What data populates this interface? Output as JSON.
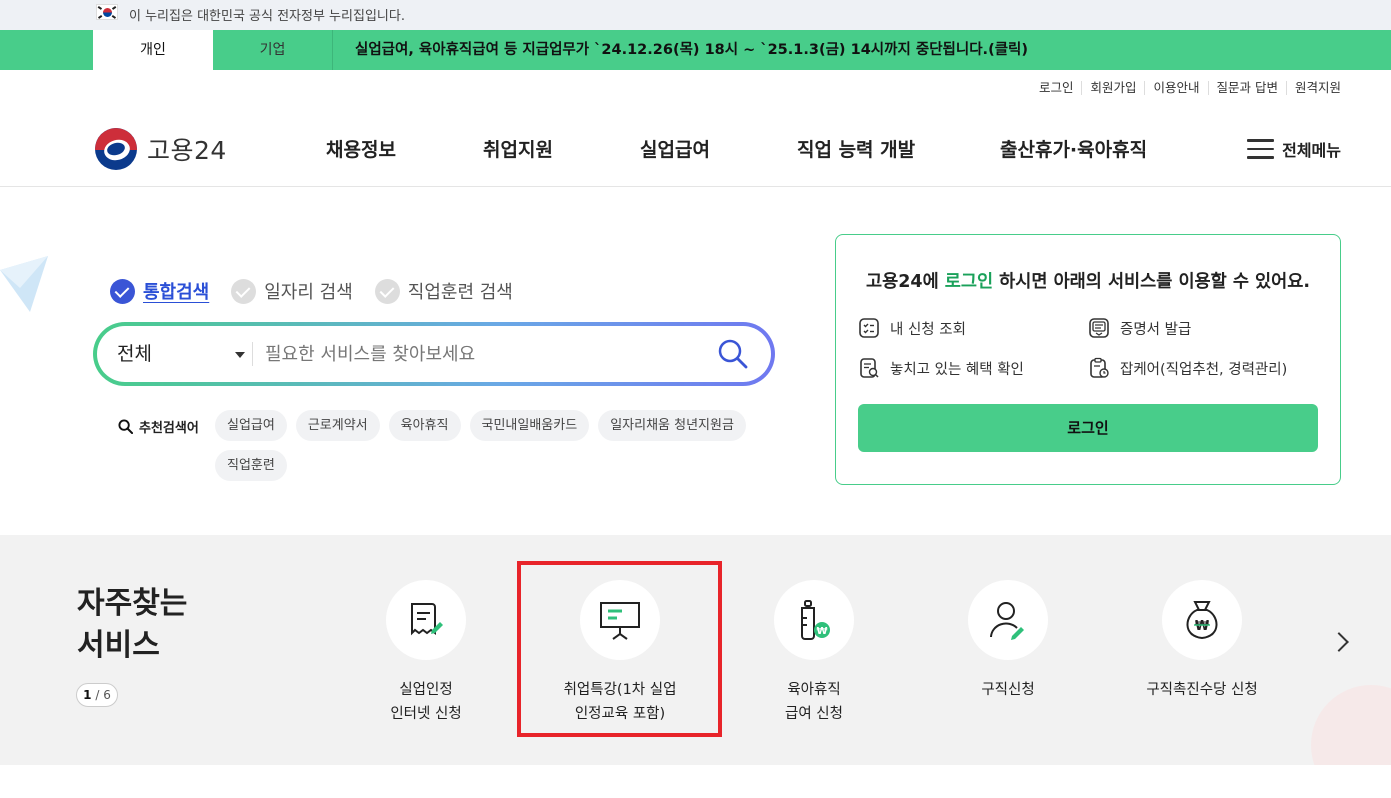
{
  "gov_banner": {
    "text": "이 누리집은 대한민국 공식 전자정부 누리집입니다."
  },
  "user_tabs": {
    "personal": "개인",
    "business": "기업"
  },
  "notice": "실업급여, 육아휴직급여 등 지급업무가 `24.12.26(목) 18시 ~ `25.1.3(금) 14시까지 중단됩니다.(클릭)",
  "util_links": [
    "로그인",
    "회원가입",
    "이용안내",
    "질문과 답변",
    "원격지원"
  ],
  "logo": {
    "name": "고용24"
  },
  "gnb": [
    "채용정보",
    "취업지원",
    "실업급여",
    "직업 능력 개발",
    "출산휴가·육아휴직"
  ],
  "menu_all": "전체메뉴",
  "search": {
    "tabs": [
      "통합검색",
      "일자리 검색",
      "직업훈련 검색"
    ],
    "active_tab": 0,
    "category": "전체",
    "placeholder": "필요한 서비스를 찾아보세요",
    "keyword_label": "추천검색어",
    "keywords": [
      "실업급여",
      "근로계약서",
      "육아휴직",
      "국민내일배움카드",
      "일자리채움 청년지원금",
      "직업훈련"
    ]
  },
  "login_box": {
    "title_prefix": "고용24에 ",
    "title_highlight": "로그인",
    "title_suffix": " 하시면 아래의 서비스를 이용할 수 있어요.",
    "services": [
      "내 신청 조회",
      "증명서 발급",
      "놓치고 있는 혜택 확인",
      "잡케어(직업추천, 경력관리)"
    ],
    "button": "로그인"
  },
  "frequent": {
    "title_line1": "자주찾는",
    "title_line2": "서비스",
    "page_current": "1",
    "page_total": " / 6",
    "items": [
      {
        "line1": "실업인정",
        "line2": "인터넷 신청",
        "icon": "document-pen-icon"
      },
      {
        "line1": "취업특강(1차 실업",
        "line2": "인정교육 포함)",
        "icon": "presentation-board-icon"
      },
      {
        "line1": "육아휴직",
        "line2": "급여 신청",
        "icon": "baby-bottle-won-icon"
      },
      {
        "line1": "구직신청",
        "line2": "",
        "icon": "person-pen-icon"
      },
      {
        "line1": "구직촉진수당 신청",
        "line2": "",
        "icon": "money-bag-icon"
      }
    ]
  },
  "colors": {
    "brand_green": "#48cd8a",
    "accent_blue": "#3a55d6",
    "highlight_red": "#e8242a"
  }
}
